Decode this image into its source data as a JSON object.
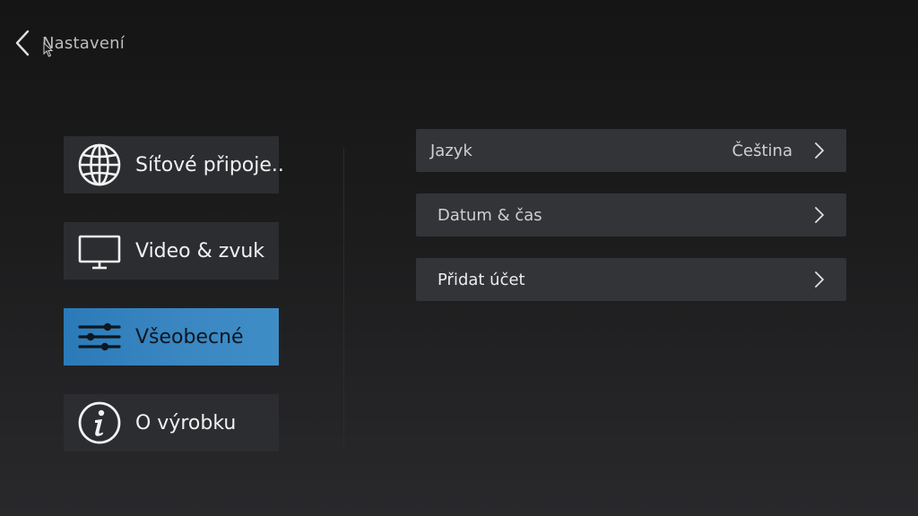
{
  "header": {
    "title": "Nastavení",
    "back_icon": "chevron-left-icon"
  },
  "sidebar": {
    "items": [
      {
        "label": "Síťové připoje..",
        "icon": "globe-icon",
        "active": false
      },
      {
        "label": "Video & zvuk",
        "icon": "monitor-icon",
        "active": false
      },
      {
        "label": "Všeobecné",
        "icon": "sliders-icon",
        "active": true
      },
      {
        "label": "O výrobku",
        "icon": "info-icon",
        "active": false
      }
    ]
  },
  "options": {
    "items": [
      {
        "label": "Jazyk",
        "value": "Čeština",
        "icon": "chevron-right-icon"
      },
      {
        "label": "Datum & čas",
        "value": "",
        "icon": "chevron-right-icon"
      },
      {
        "label": "Přidat účet",
        "value": "",
        "icon": "chevron-right-icon"
      }
    ]
  },
  "colors": {
    "accent": "#3a87c2",
    "item_background": "#2c2d30",
    "row_background": "#333438"
  }
}
